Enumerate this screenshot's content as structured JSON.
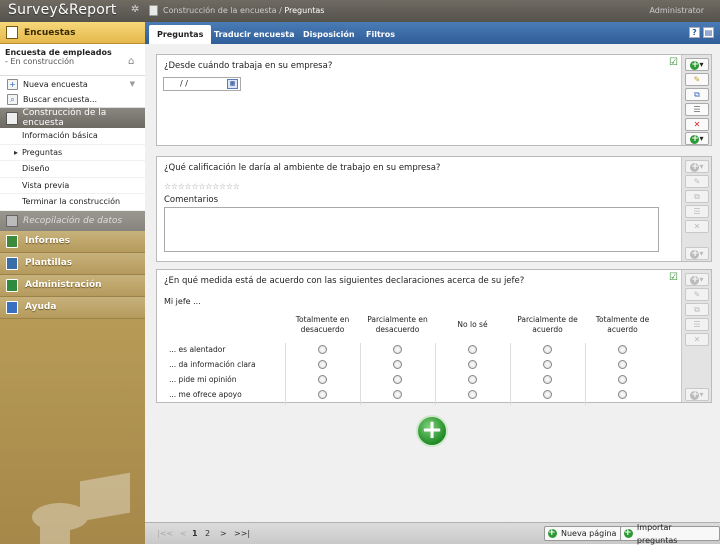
{
  "app": {
    "logo": "Survey&Report",
    "breadcrumb_parent": "Construcción de la encuesta /",
    "breadcrumb_current": "Preguntas",
    "user": "Administrator"
  },
  "sidebar": {
    "surveys_header": "Encuestas",
    "survey_name": "Encuesta de empleados",
    "survey_status": "- En construcción",
    "actions": [
      {
        "label": "Nueva encuesta",
        "icon": "new-survey-icon"
      },
      {
        "label": "Buscar encuesta...",
        "icon": "search-survey-icon"
      }
    ],
    "build_section": "Construcción de la encuesta",
    "build_items": [
      "Información básica",
      "Preguntas",
      "Diseño",
      "Vista previa",
      "Terminar la construcción"
    ],
    "data_section": "Recopilación de datos",
    "categories": [
      {
        "label": "Informes",
        "icon": "reports-icon",
        "color": "#3c8a3a"
      },
      {
        "label": "Plantillas",
        "icon": "templates-icon",
        "color": "#3a6ea8"
      },
      {
        "label": "Administración",
        "icon": "admin-icon",
        "color": "#2e8a3e"
      },
      {
        "label": "Ayuda",
        "icon": "help-icon",
        "color": "#3a6ec0"
      }
    ]
  },
  "tabs": [
    "Preguntas",
    "Traducir encuesta",
    "Disposición",
    "Filtros"
  ],
  "questions": [
    {
      "text": "¿Desde cuándo trabaja en su empresa?",
      "date_value": "/    /"
    },
    {
      "text": "¿Qué calificación le daría al ambiente de trabajo en su empresa?",
      "stars": "☆☆☆☆☆☆☆☆☆☆☆",
      "comment_label": "Comentarios"
    },
    {
      "text": "¿En qué medida está de acuerdo con las siguientes declaraciones acerca de su jefe?",
      "intro": "Mi jefe ...",
      "columns": [
        "Totalmente en desacuerdo",
        "Parcialmente en desacuerdo",
        "No lo sé",
        "Parcialmente de acuerdo",
        "Totalmente de acuerdo"
      ],
      "rows": [
        "... es alentador",
        "... da información clara",
        "... pide mi opinión",
        "... me ofrece apoyo"
      ]
    }
  ],
  "pagination": {
    "first": "|<<",
    "prev": "<",
    "pages": [
      "1",
      "2"
    ],
    "next": ">",
    "last": ">>|",
    "current": "1"
  },
  "buttons": {
    "new_page": "Nueva página",
    "import": "Importar preguntas"
  }
}
